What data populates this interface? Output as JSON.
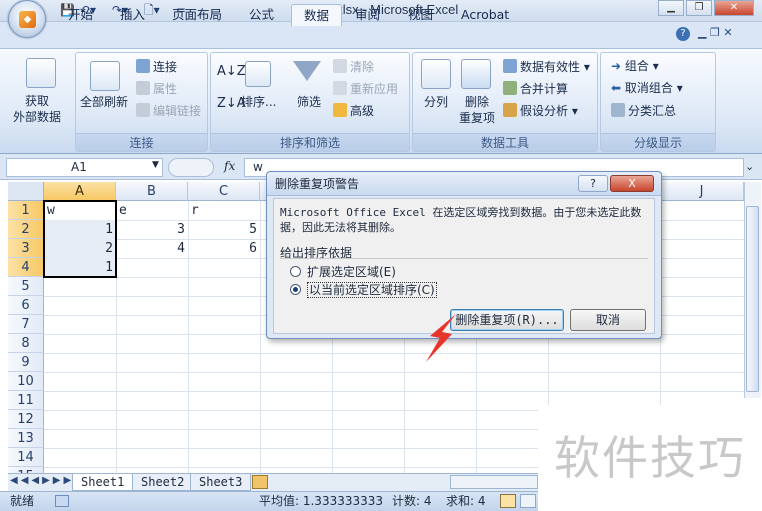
{
  "window": {
    "title": "dggh.xlsx - Microsoft Excel"
  },
  "qat": {
    "save_icon": "save-icon",
    "undo_icon": "undo-icon",
    "redo_icon": "redo-icon",
    "preview_icon": "print-preview-icon",
    "more": "="
  },
  "tabs": [
    {
      "label": "开始"
    },
    {
      "label": "插入"
    },
    {
      "label": "页面布局"
    },
    {
      "label": "公式"
    },
    {
      "label": "数据"
    },
    {
      "label": "审阅"
    },
    {
      "label": "视图"
    },
    {
      "label": "Acrobat"
    }
  ],
  "ribbon": {
    "get_external": {
      "line1": "获取",
      "line2": "外部数据"
    },
    "refresh_all": "全部刷新",
    "connections": "连接",
    "properties": "属性",
    "edit_links": "编辑链接",
    "connect_group": "连接",
    "sort": "排序...",
    "filter": "筛选",
    "clear": "清除",
    "reapply": "重新应用",
    "advanced": "高级",
    "sort_group": "排序和筛选",
    "text_to_columns": "分列",
    "remove_dup": {
      "line1": "删除",
      "line2": "重复项"
    },
    "data_validation": "数据有效性",
    "consolidate": "合并计算",
    "whatif": "假设分析",
    "tools_group": "数据工具",
    "group": "组合",
    "ungroup": "取消组合",
    "subtotal": "分类汇总",
    "outline_group": "分级显示"
  },
  "formula": {
    "namebox": "A1",
    "fx": "fx",
    "value": "w"
  },
  "columns": [
    "A",
    "B",
    "C",
    "J"
  ],
  "rows": [
    "1",
    "2",
    "3",
    "4",
    "5",
    "6",
    "7",
    "8",
    "9",
    "10",
    "11",
    "12",
    "13",
    "14",
    "15"
  ],
  "cells": {
    "A1": "w",
    "B1": "e",
    "C1": "r",
    "A2": "1",
    "B2": "3",
    "C2": "5",
    "A3": "2",
    "B3": "4",
    "C3": "6",
    "A4": "1"
  },
  "sheets": [
    {
      "label": "Sheet1"
    },
    {
      "label": "Sheet2"
    },
    {
      "label": "Sheet3"
    }
  ],
  "status": {
    "ready": "就绪",
    "average": "平均值: 1.333333333",
    "count": "计数: 4",
    "sum": "求和: 4"
  },
  "dialog": {
    "title": "删除重复项警告",
    "message": "Microsoft Office Excel 在选定区域旁找到数据。由于您未选定此数据，因此无法将其删除。",
    "group_label": "给出排序依据",
    "option_expand": "扩展选定区域(E)",
    "option_current": "以当前选定区域排序(C)",
    "btn_remove": "删除重复项(R)...",
    "btn_cancel": "取消",
    "help": "?",
    "close": "X"
  },
  "watermark": "软件技巧"
}
